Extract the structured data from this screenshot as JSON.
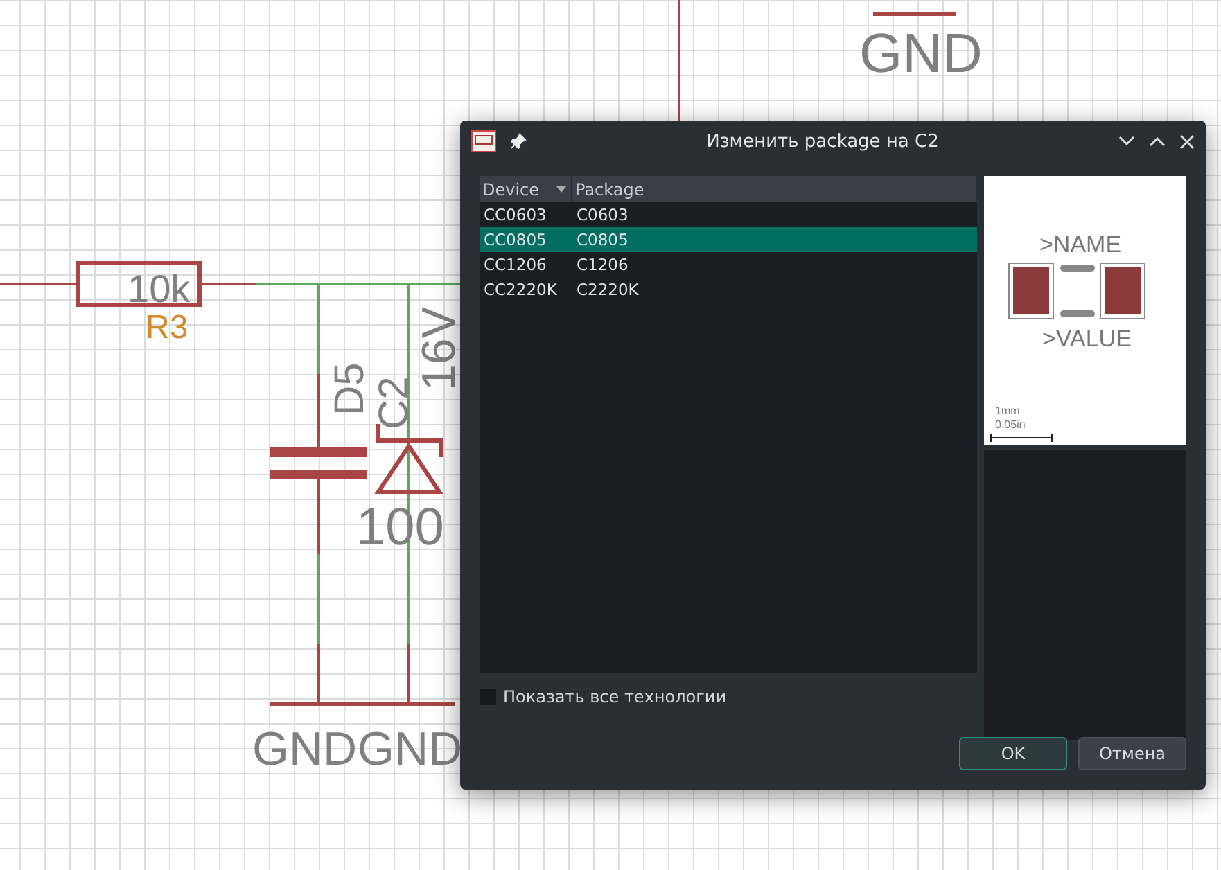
{
  "schematic": {
    "labels": [
      {
        "text": "GND",
        "kind": "net"
      },
      {
        "text": "10k",
        "kind": "value"
      },
      {
        "text": "R3",
        "kind": "name"
      },
      {
        "text": "D5",
        "kind": "value"
      },
      {
        "text": "C2",
        "kind": "value"
      },
      {
        "text": "16V",
        "kind": "value"
      },
      {
        "text": "100",
        "kind": "value"
      },
      {
        "text": "GND",
        "kind": "net"
      },
      {
        "text": "GND",
        "kind": "net"
      }
    ]
  },
  "dialog": {
    "title": "Изменить package на C2",
    "table": {
      "columns": [
        "Device",
        "Package"
      ],
      "rows": [
        {
          "cells": [
            "CC0603",
            "C0603"
          ],
          "selected": false
        },
        {
          "cells": [
            "CC0805",
            "C0805"
          ],
          "selected": true
        },
        {
          "cells": [
            "CC1206",
            "C1206"
          ],
          "selected": false
        },
        {
          "cells": [
            "CC2220K",
            "C2220K"
          ],
          "selected": false
        }
      ]
    },
    "show_all_technologies": {
      "label": "Показать все технологии",
      "checked": false
    },
    "preview": {
      "name": ">NAME",
      "value": ">VALUE",
      "scale_top": "1mm",
      "scale_bottom": "0.05in"
    },
    "buttons": [
      {
        "label": "OK",
        "kind": "default"
      },
      {
        "label": "Отмена",
        "kind": "normal"
      }
    ]
  }
}
